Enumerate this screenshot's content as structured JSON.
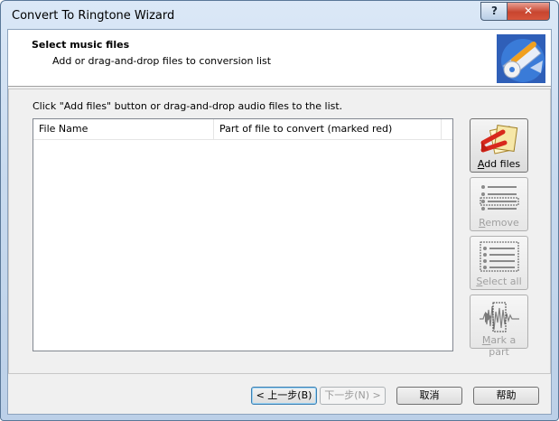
{
  "window": {
    "title": "Convert To Ringtone Wizard",
    "help_button": "?",
    "close_button": "✕"
  },
  "header": {
    "title": "Select music files",
    "subtitle": "Add or drag-and-drop files to conversion list",
    "logo_icon": "ringtone-wizard-logo-icon"
  },
  "main": {
    "instruction": "Click \"Add files\" button or drag-and-drop audio files to the list.",
    "columns": [
      "File Name",
      "Part of file to convert (marked red)"
    ],
    "rows": []
  },
  "side_buttons": {
    "add_files": {
      "accel": "A",
      "rest": "dd files",
      "icon": "add-files-icon",
      "enabled": true
    },
    "remove": {
      "accel": "R",
      "rest": "emove",
      "icon": "remove-list-icon",
      "enabled": false
    },
    "select_all": {
      "accel": "S",
      "rest": "elect all",
      "icon": "select-all-icon",
      "enabled": false
    },
    "mark_part": {
      "accel": "M",
      "rest": "ark a part",
      "icon": "waveform-mark-icon",
      "enabled": false
    }
  },
  "footer": {
    "back": "< 上一步(B)",
    "next": "下一步(N) >",
    "cancel": "取消",
    "help": "帮助"
  },
  "colors": {
    "titlebar": "#c9dbef",
    "close": "#c8452f",
    "client": "#f0f0f0",
    "disabled_text": "#a0a0a0"
  }
}
